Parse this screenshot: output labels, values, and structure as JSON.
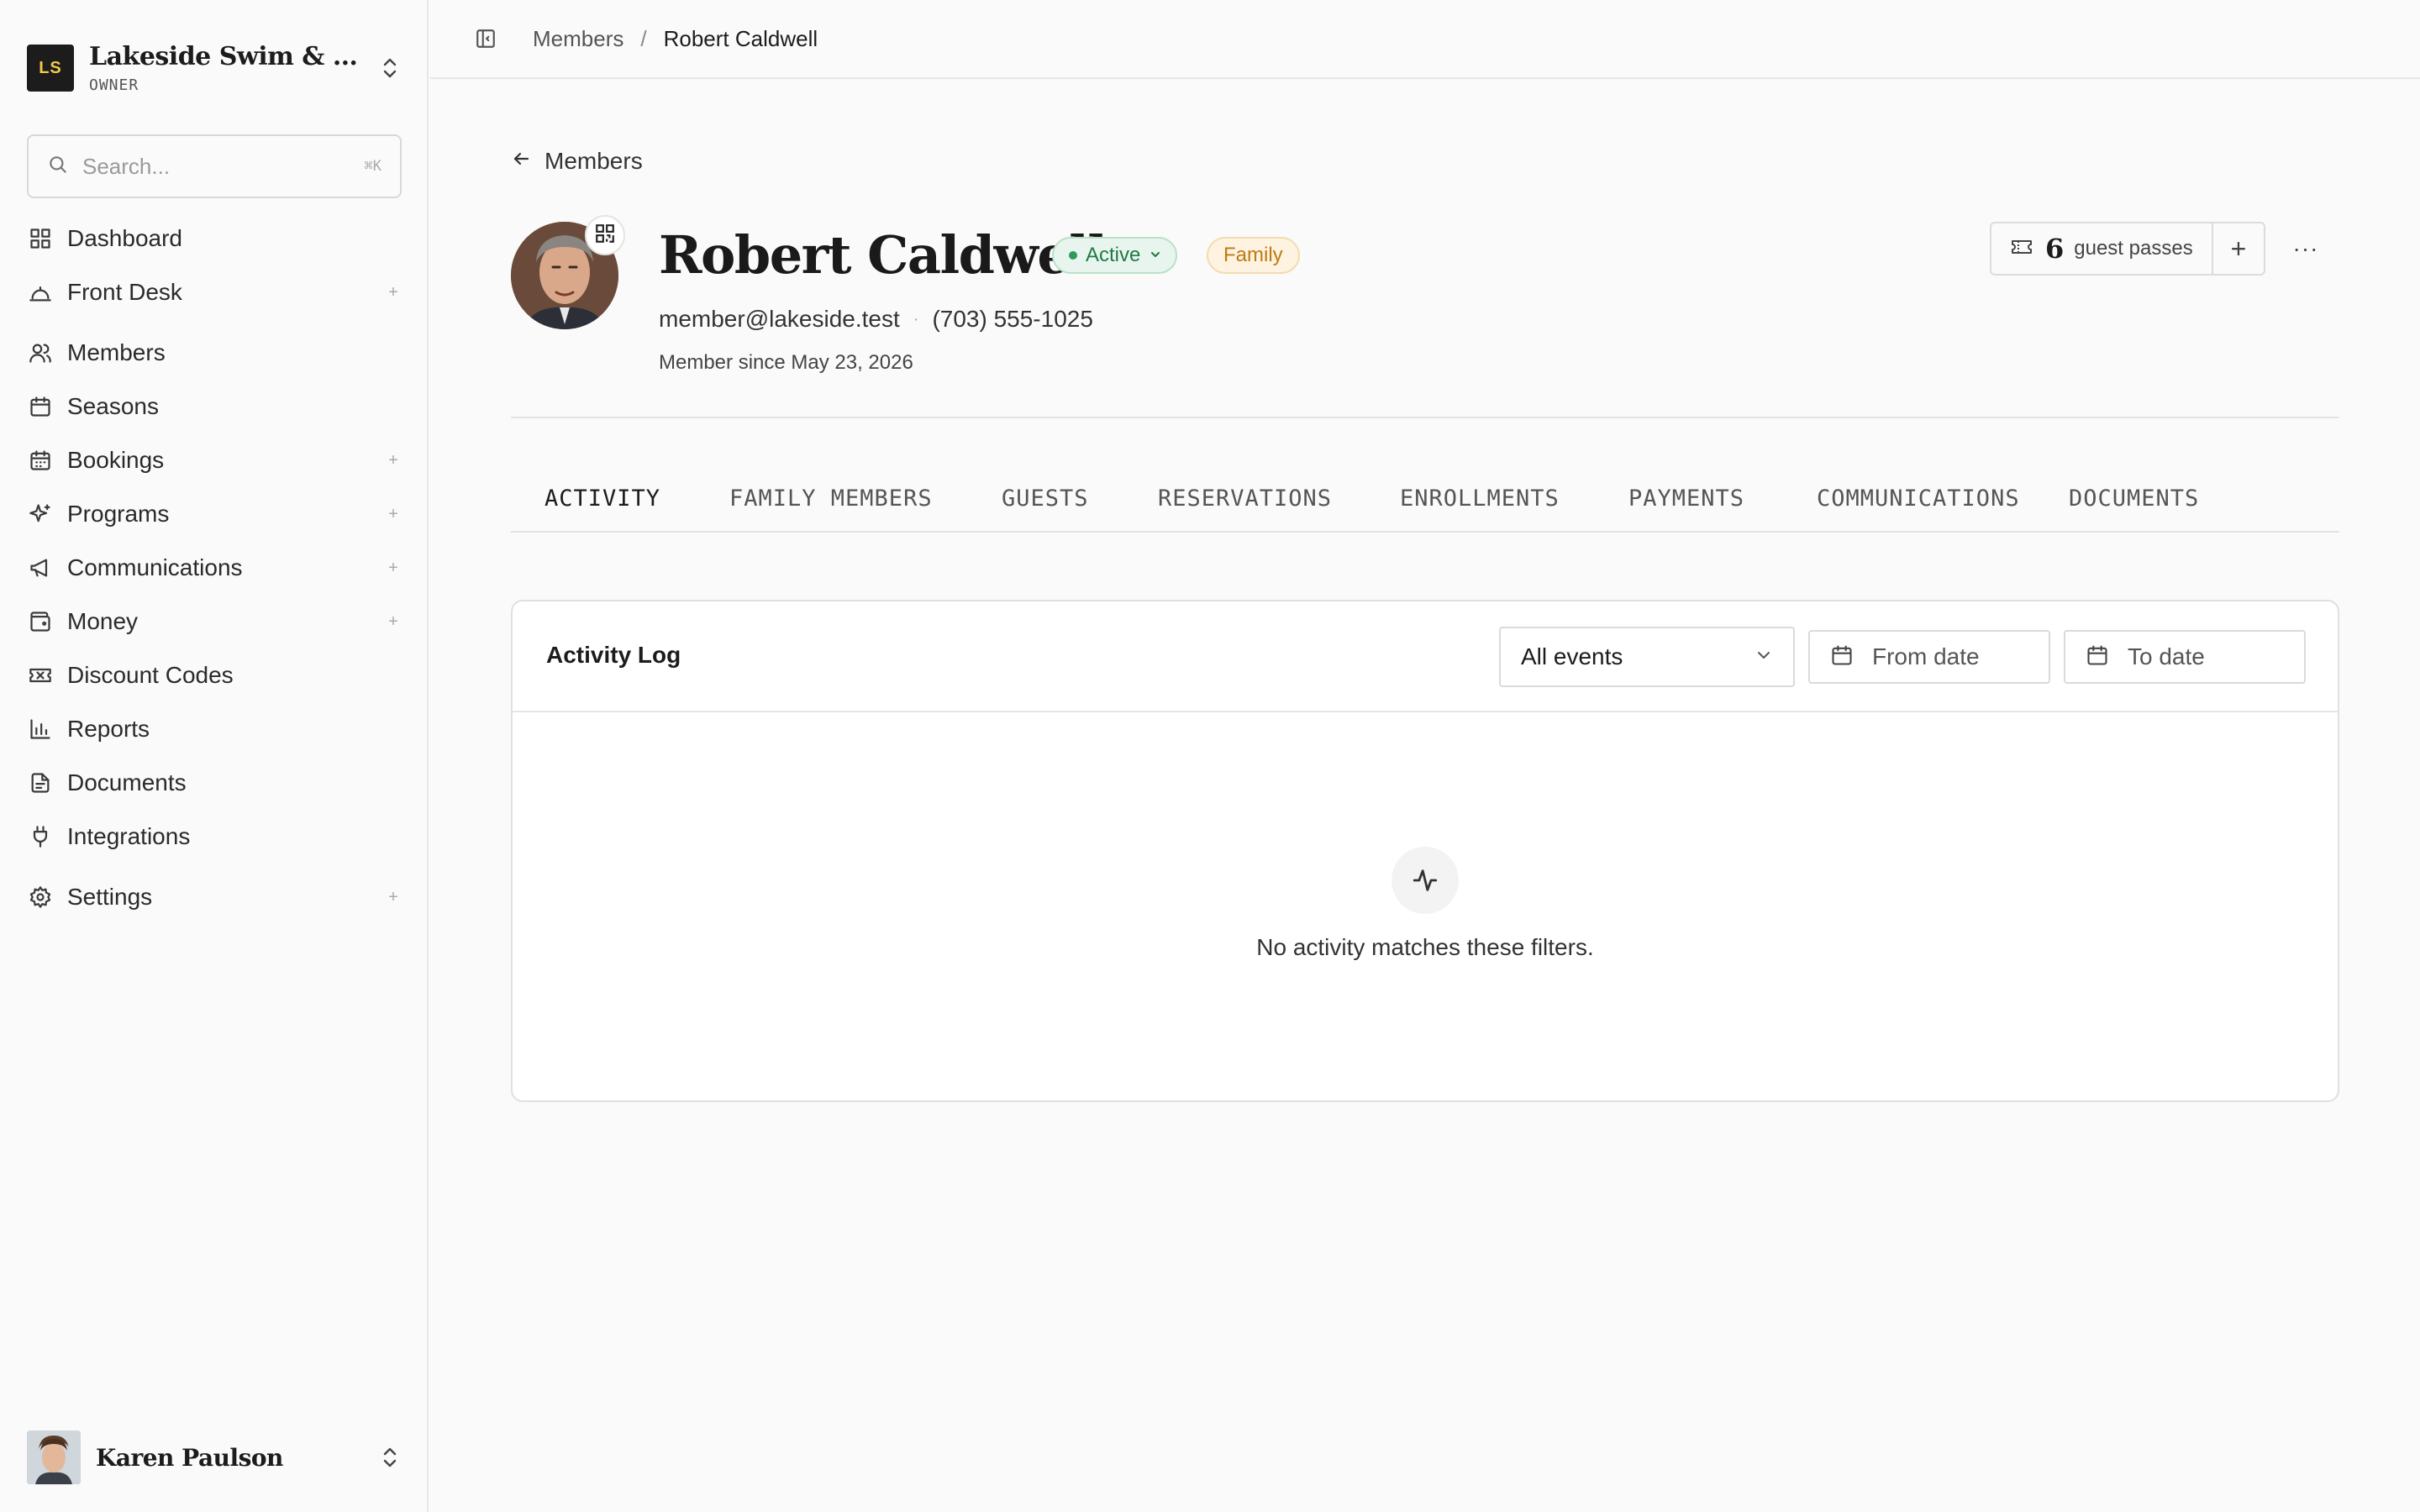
{
  "org": {
    "initials": "LS",
    "name": "Lakeside Swim & Tennis Club",
    "role": "OWNER"
  },
  "search": {
    "placeholder": "Search...",
    "shortcut": "⌘K"
  },
  "nav": [
    {
      "label": "Dashboard",
      "icon": "dashboard-icon",
      "expandable": false
    },
    {
      "label": "Front Desk",
      "icon": "bell-icon",
      "expandable": true
    },
    {
      "label": "Members",
      "icon": "users-icon",
      "expandable": false
    },
    {
      "label": "Seasons",
      "icon": "calendar-icon",
      "expandable": false
    },
    {
      "label": "Bookings",
      "icon": "calendar-grid-icon",
      "expandable": true
    },
    {
      "label": "Programs",
      "icon": "sparkles-icon",
      "expandable": true
    },
    {
      "label": "Communications",
      "icon": "megaphone-icon",
      "expandable": true
    },
    {
      "label": "Money",
      "icon": "wallet-icon",
      "expandable": true
    },
    {
      "label": "Discount Codes",
      "icon": "ticket-icon",
      "expandable": false
    },
    {
      "label": "Reports",
      "icon": "bar-chart-icon",
      "expandable": false
    },
    {
      "label": "Documents",
      "icon": "document-icon",
      "expandable": false
    },
    {
      "label": "Integrations",
      "icon": "plug-icon",
      "expandable": false
    },
    {
      "label": "Settings",
      "icon": "gear-icon",
      "expandable": true
    }
  ],
  "nav_plus": "+",
  "user": {
    "name": "Karen Paulson"
  },
  "breadcrumb": {
    "parent": "Members",
    "separator": "/",
    "current": "Robert Caldwell"
  },
  "back": {
    "label": "Members"
  },
  "member": {
    "name": "Robert Caldwell",
    "status": "Active",
    "plan": "Family",
    "email": "member@lakeside.test",
    "phone": "(703) 555-1025",
    "since": "Member since May 23, 2026"
  },
  "guest_passes": {
    "count": "6",
    "label": "guest passes",
    "add": "+",
    "more": "···"
  },
  "tabs": [
    "ACTIVITY",
    "FAMILY MEMBERS",
    "GUESTS",
    "RESERVATIONS",
    "ENROLLMENTS",
    "PAYMENTS",
    "COMMUNICATIONS",
    "DOCUMENTS"
  ],
  "activity": {
    "title": "Activity Log",
    "filter": "All events",
    "from_placeholder": "From date",
    "to_placeholder": "To date",
    "empty": "No activity matches these filters."
  },
  "colors": {
    "active_green": "#1f7a44",
    "family_amber": "#c07a12",
    "logo_bg": "#1c1c1c",
    "logo_fg": "#f2c94c"
  }
}
